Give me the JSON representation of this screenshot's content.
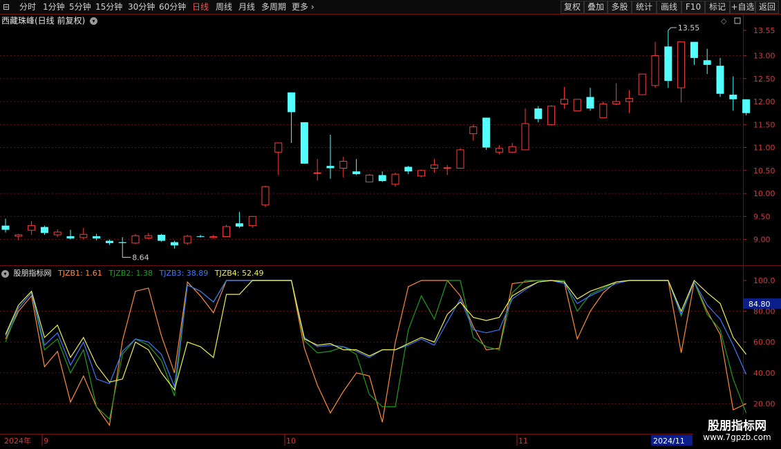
{
  "toolbar": {
    "menu_glyph": "⊟",
    "periods": [
      "分时",
      "1分钟",
      "5分钟",
      "15分钟",
      "30分钟",
      "60分钟",
      "日线",
      "周线",
      "月线",
      "多周期",
      "更多 ›"
    ],
    "active_period": "日线",
    "right_buttons": [
      "复权",
      "叠加",
      "多股",
      "统计",
      "画线",
      "F10",
      "标记",
      "+自选",
      "返回"
    ]
  },
  "stock_header": {
    "title": "西藏珠峰(日线 前复权)",
    "dropdown_icon": "chevron-down-icon"
  },
  "price_panel": {
    "right_axis_ticks": [
      "13.55",
      "13.00",
      "12.50",
      "12.00",
      "11.50",
      "11.00",
      "10.50",
      "10.00",
      "9.50",
      "9.00"
    ],
    "high_label": "13.55",
    "low_label": "8.64"
  },
  "indicator": {
    "name": "股朋指标网",
    "lines": [
      {
        "label": "TJZB1: 1.61",
        "color": "#ff8c3c"
      },
      {
        "label": "TJZB2: 1.38",
        "color": "#1e9e1e"
      },
      {
        "label": "TJZB3: 38.89",
        "color": "#3c78ff"
      },
      {
        "label": "TJZB4: 52.49",
        "color": "#f0f050"
      }
    ],
    "axis_ticks": [
      "100.0",
      "80.00",
      "60.00",
      "40.00",
      "20.00"
    ],
    "cursor_value": "84.80"
  },
  "date_axis": {
    "labels": [
      "2024年",
      "9",
      "10",
      "11"
    ],
    "cursor_date": "2024/11"
  },
  "watermark": {
    "title": "股朋指标网",
    "url": "www.7gpzb.com"
  },
  "colors": {
    "up": "#ff3c3c",
    "down": "#54ffff",
    "background": "#000000",
    "grid": "#6e1010"
  },
  "chart_data": {
    "type": "candlestick",
    "candles": [
      [
        9.3,
        9.21,
        9.45,
        9.15
      ],
      [
        9.07,
        9.1,
        9.12,
        8.98
      ],
      [
        9.2,
        9.3,
        9.4,
        9.1
      ],
      [
        9.27,
        9.14,
        9.3,
        9.1
      ],
      [
        9.1,
        9.16,
        9.22,
        9.05
      ],
      [
        9.07,
        9.02,
        9.21,
        9.0
      ],
      [
        9.04,
        9.11,
        9.25,
        9.0
      ],
      [
        9.07,
        9.02,
        9.12,
        8.98
      ],
      [
        8.97,
        8.92,
        9.0,
        8.88
      ],
      [
        8.94,
        8.92,
        9.05,
        8.85
      ],
      [
        8.92,
        9.08,
        9.12,
        8.9
      ],
      [
        9.03,
        9.08,
        9.14,
        9.0
      ],
      [
        9.1,
        8.97,
        9.12,
        8.95
      ],
      [
        8.94,
        8.87,
        8.97,
        8.8
      ],
      [
        8.92,
        9.07,
        9.1,
        8.88
      ],
      [
        9.07,
        9.06,
        9.1,
        9.04
      ],
      [
        9.04,
        9.06,
        9.1,
        9.02
      ],
      [
        9.06,
        9.28,
        9.32,
        9.05
      ],
      [
        9.35,
        9.28,
        9.6,
        9.25
      ],
      [
        9.3,
        9.5,
        9.5,
        9.25
      ],
      [
        9.75,
        10.15,
        10.17,
        9.7
      ],
      [
        10.9,
        11.1,
        11.1,
        10.4
      ],
      [
        12.2,
        11.77,
        12.2,
        11.1
      ],
      [
        11.55,
        10.65,
        11.55,
        10.65
      ],
      [
        10.45,
        10.45,
        10.75,
        10.28
      ],
      [
        10.6,
        10.55,
        11.28,
        10.32
      ],
      [
        10.55,
        10.7,
        10.8,
        10.35
      ],
      [
        10.48,
        10.42,
        10.75,
        10.4
      ],
      [
        10.25,
        10.4,
        10.42,
        10.25
      ],
      [
        10.4,
        10.27,
        10.48,
        10.25
      ],
      [
        10.2,
        10.42,
        10.45,
        10.15
      ],
      [
        10.58,
        10.48,
        10.6,
        10.42
      ],
      [
        10.38,
        10.5,
        10.52,
        10.35
      ],
      [
        10.55,
        10.62,
        10.75,
        10.45
      ],
      [
        10.56,
        10.56,
        10.62,
        10.4
      ],
      [
        10.55,
        10.95,
        10.98,
        10.55
      ],
      [
        11.3,
        11.45,
        11.5,
        11.15
      ],
      [
        11.65,
        11.0,
        11.65,
        10.95
      ],
      [
        10.9,
        10.98,
        11.05,
        10.85
      ],
      [
        10.9,
        11.02,
        11.1,
        10.88
      ],
      [
        10.95,
        11.52,
        11.85,
        10.95
      ],
      [
        11.85,
        11.62,
        11.9,
        11.55
      ],
      [
        11.5,
        11.9,
        11.92,
        11.48
      ],
      [
        11.95,
        12.05,
        12.32,
        11.85
      ],
      [
        11.8,
        12.05,
        12.05,
        11.8
      ],
      [
        12.1,
        11.85,
        12.3,
        11.8
      ],
      [
        11.65,
        11.95,
        12.0,
        11.65
      ],
      [
        11.95,
        12.0,
        12.4,
        11.92
      ],
      [
        12.0,
        12.07,
        12.25,
        11.75
      ],
      [
        12.15,
        12.6,
        12.6,
        12.15
      ],
      [
        12.35,
        13.0,
        13.3,
        12.3
      ],
      [
        13.2,
        12.45,
        13.55,
        12.3
      ],
      [
        12.3,
        13.3,
        13.3,
        11.98
      ],
      [
        13.3,
        12.95,
        13.3,
        12.8
      ],
      [
        12.9,
        12.8,
        13.15,
        12.6
      ],
      [
        12.78,
        12.17,
        12.95,
        12.1
      ],
      [
        12.15,
        12.05,
        12.55,
        11.8
      ],
      [
        12.05,
        11.75,
        12.05,
        11.7
      ]
    ],
    "indicator_series": [
      {
        "name": "TJZB1",
        "values": [
          62,
          80,
          90,
          44,
          54,
          21,
          38,
          18,
          6,
          61,
          93,
          95,
          64,
          40,
          99,
          90,
          79,
          100,
          100,
          100,
          100,
          100,
          100,
          56,
          32,
          14,
          28,
          40,
          38,
          8,
          60,
          96,
          100,
          100,
          100,
          90,
          70,
          55,
          56,
          98,
          99,
          100,
          100,
          99,
          62,
          80,
          92,
          99,
          100,
          100,
          100,
          100,
          53,
          99,
          80,
          65,
          16,
          20
        ]
      },
      {
        "name": "TJZB2",
        "values": [
          60,
          82,
          92,
          55,
          62,
          40,
          55,
          18,
          10,
          52,
          62,
          58,
          48,
          25,
          97,
          93,
          86,
          100,
          100,
          100,
          100,
          100,
          100,
          61,
          53,
          54,
          57,
          52,
          26,
          18,
          18,
          68,
          90,
          75,
          100,
          100,
          63,
          57,
          55,
          92,
          100,
          100,
          100,
          100,
          80,
          91,
          95,
          99,
          100,
          100,
          100,
          100,
          77,
          99,
          78,
          68,
          36,
          14
        ]
      },
      {
        "name": "TJZB3",
        "values": [
          64,
          82,
          92,
          58,
          66,
          45,
          60,
          36,
          33,
          54,
          62,
          60,
          52,
          31,
          97,
          93,
          86,
          100,
          100,
          100,
          100,
          100,
          100,
          63,
          57,
          58,
          57,
          54,
          50,
          55,
          55,
          58,
          62,
          58,
          73,
          88,
          68,
          66,
          68,
          88,
          94,
          99,
          100,
          98,
          85,
          90,
          94,
          98,
          100,
          100,
          100,
          100,
          78,
          99,
          84,
          75,
          58,
          39
        ]
      },
      {
        "name": "TJZB4",
        "values": [
          65,
          84,
          93,
          63,
          71,
          50,
          63,
          45,
          34,
          36,
          60,
          55,
          40,
          29,
          60,
          57,
          50,
          91,
          91,
          100,
          100,
          100,
          100,
          62,
          58,
          59,
          55,
          55,
          51,
          55,
          55,
          59,
          63,
          60,
          78,
          86,
          76,
          74,
          76,
          90,
          95,
          99,
          100,
          99,
          88,
          93,
          96,
          99,
          100,
          100,
          100,
          100,
          80,
          100,
          92,
          85,
          63,
          52
        ]
      }
    ]
  }
}
